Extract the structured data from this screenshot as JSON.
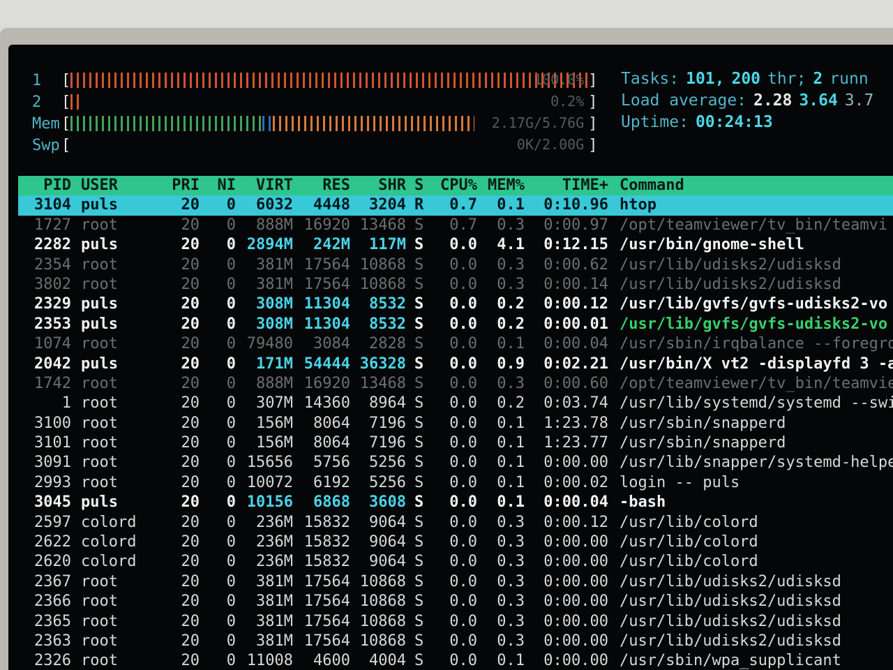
{
  "meters": [
    {
      "label": "1",
      "text": "100.0%",
      "fill": 1.0,
      "segments": [
        {
          "color": "red",
          "frac": 1.0
        }
      ]
    },
    {
      "label": "2",
      "text": "0.2%",
      "fill": 0.02,
      "segments": [
        {
          "color": "red",
          "frac": 0.02
        }
      ]
    },
    {
      "label": "Mem",
      "text": "2.17G/5.76G",
      "fill": 0.78,
      "segments": [
        {
          "color": "green",
          "frac": 0.37
        },
        {
          "color": "blue",
          "frac": 0.02
        },
        {
          "color": "orange",
          "frac": 0.39
        }
      ]
    },
    {
      "label": "Swp",
      "text": "0K/2.00G",
      "fill": 0.0,
      "segments": []
    }
  ],
  "stats": {
    "tasks_label": "Tasks:",
    "tasks_value": "101,",
    "threads_value": "200",
    "threads_label": "thr;",
    "running_value": "2",
    "running_label": "runn",
    "load_label": "Load average:",
    "load_1": "2.28",
    "load_5": "3.64",
    "load_15": "3.7",
    "uptime_label": "Uptime:",
    "uptime_value": "00:24:13"
  },
  "columns": [
    "PID",
    "USER",
    "PRI",
    "NI",
    "VIRT",
    "RES",
    "SHR",
    "S",
    "CPU%",
    "MEM%",
    "TIME+",
    "Command"
  ],
  "processes": [
    {
      "pid": "3104",
      "user": "puls",
      "pri": "20",
      "ni": "0",
      "virt": "6032",
      "res": "4448",
      "shr": "3204",
      "s": "R",
      "cpu": "0.7",
      "mem": "0.1",
      "time": "0:10.96",
      "cmd": "htop",
      "style": "sel"
    },
    {
      "pid": "1727",
      "user": "root",
      "pri": "20",
      "ni": "0",
      "virt": "888M",
      "res": "16920",
      "shr": "13468",
      "s": "S",
      "cpu": "0.7",
      "mem": "0.3",
      "time": "0:00.97",
      "cmd": "/opt/teamviewer/tv_bin/teamvi",
      "style": "dim"
    },
    {
      "pid": "2282",
      "user": "puls",
      "pri": "20",
      "ni": "0",
      "virt": "2894M",
      "res": "242M",
      "shr": "117M",
      "s": "S",
      "cpu": "0.0",
      "mem": "4.1",
      "time": "0:12.15",
      "cmd": "/usr/bin/gnome-shell",
      "style": "bright"
    },
    {
      "pid": "2354",
      "user": "root",
      "pri": "20",
      "ni": "0",
      "virt": "381M",
      "res": "17564",
      "shr": "10868",
      "s": "S",
      "cpu": "0.0",
      "mem": "0.3",
      "time": "0:00.62",
      "cmd": "/usr/lib/udisks2/udisksd",
      "style": "dim"
    },
    {
      "pid": "3802",
      "user": "root",
      "pri": "20",
      "ni": "0",
      "virt": "381M",
      "res": "17564",
      "shr": "10868",
      "s": "S",
      "cpu": "0.0",
      "mem": "0.3",
      "time": "0:00.14",
      "cmd": "/usr/lib/udisks2/udisksd",
      "style": "dim"
    },
    {
      "pid": "2329",
      "user": "puls",
      "pri": "20",
      "ni": "0",
      "virt": "308M",
      "res": "11304",
      "shr": "8532",
      "s": "S",
      "cpu": "0.0",
      "mem": "0.2",
      "time": "0:00.12",
      "cmd": "/usr/lib/gvfs/gvfs-udisks2-vo",
      "style": "bright"
    },
    {
      "pid": "2353",
      "user": "puls",
      "pri": "20",
      "ni": "0",
      "virt": "308M",
      "res": "11304",
      "shr": "8532",
      "s": "S",
      "cpu": "0.0",
      "mem": "0.2",
      "time": "0:00.01",
      "cmd": "/usr/lib/gvfs/gvfs-udisks2-vo",
      "style": "bright",
      "cmdcolor": "green"
    },
    {
      "pid": "1074",
      "user": "root",
      "pri": "20",
      "ni": "0",
      "virt": "79480",
      "res": "3084",
      "shr": "2828",
      "s": "S",
      "cpu": "0.0",
      "mem": "0.1",
      "time": "0:00.04",
      "cmd": "/usr/sbin/irqbalance --foregro",
      "style": "dim"
    },
    {
      "pid": "2042",
      "user": "puls",
      "pri": "20",
      "ni": "0",
      "virt": "171M",
      "res": "54444",
      "shr": "36328",
      "s": "S",
      "cpu": "0.0",
      "mem": "0.9",
      "time": "0:02.21",
      "cmd": "/usr/bin/X vt2 -displayfd 3 -a",
      "style": "bright"
    },
    {
      "pid": "1742",
      "user": "root",
      "pri": "20",
      "ni": "0",
      "virt": "888M",
      "res": "16920",
      "shr": "13468",
      "s": "S",
      "cpu": "0.0",
      "mem": "0.3",
      "time": "0:00.60",
      "cmd": "/opt/teamviewer/tv_bin/teamvie",
      "style": "dim"
    },
    {
      "pid": "1",
      "user": "root",
      "pri": "20",
      "ni": "0",
      "virt": "307M",
      "res": "14360",
      "shr": "8964",
      "s": "S",
      "cpu": "0.0",
      "mem": "0.2",
      "time": "0:03.74",
      "cmd": "/usr/lib/systemd/systemd --swi",
      "style": "normal"
    },
    {
      "pid": "3100",
      "user": "root",
      "pri": "20",
      "ni": "0",
      "virt": "156M",
      "res": "8064",
      "shr": "7196",
      "s": "S",
      "cpu": "0.0",
      "mem": "0.1",
      "time": "1:23.78",
      "cmd": "/usr/sbin/snapperd",
      "style": "normal"
    },
    {
      "pid": "3101",
      "user": "root",
      "pri": "20",
      "ni": "0",
      "virt": "156M",
      "res": "8064",
      "shr": "7196",
      "s": "S",
      "cpu": "0.0",
      "mem": "0.1",
      "time": "1:23.77",
      "cmd": "/usr/sbin/snapperd",
      "style": "normal"
    },
    {
      "pid": "3091",
      "user": "root",
      "pri": "20",
      "ni": "0",
      "virt": "15656",
      "res": "5756",
      "shr": "5256",
      "s": "S",
      "cpu": "0.0",
      "mem": "0.1",
      "time": "0:00.00",
      "cmd": "/usr/lib/snapper/systemd-helpe",
      "style": "normal"
    },
    {
      "pid": "2993",
      "user": "root",
      "pri": "20",
      "ni": "0",
      "virt": "10072",
      "res": "6192",
      "shr": "5256",
      "s": "S",
      "cpu": "0.0",
      "mem": "0.1",
      "time": "0:00.02",
      "cmd": "login -- puls",
      "style": "normal"
    },
    {
      "pid": "3045",
      "user": "puls",
      "pri": "20",
      "ni": "0",
      "virt": "10156",
      "res": "6868",
      "shr": "3608",
      "s": "S",
      "cpu": "0.0",
      "mem": "0.1",
      "time": "0:00.04",
      "cmd": "-bash",
      "style": "bright"
    },
    {
      "pid": "2597",
      "user": "colord",
      "pri": "20",
      "ni": "0",
      "virt": "236M",
      "res": "15832",
      "shr": "9064",
      "s": "S",
      "cpu": "0.0",
      "mem": "0.3",
      "time": "0:00.12",
      "cmd": "/usr/lib/colord",
      "style": "normal"
    },
    {
      "pid": "2622",
      "user": "colord",
      "pri": "20",
      "ni": "0",
      "virt": "236M",
      "res": "15832",
      "shr": "9064",
      "s": "S",
      "cpu": "0.0",
      "mem": "0.3",
      "time": "0:00.00",
      "cmd": "/usr/lib/colord",
      "style": "normal"
    },
    {
      "pid": "2620",
      "user": "colord",
      "pri": "20",
      "ni": "0",
      "virt": "236M",
      "res": "15832",
      "shr": "9064",
      "s": "S",
      "cpu": "0.0",
      "mem": "0.3",
      "time": "0:00.00",
      "cmd": "/usr/lib/colord",
      "style": "normal"
    },
    {
      "pid": "2367",
      "user": "root",
      "pri": "20",
      "ni": "0",
      "virt": "381M",
      "res": "17564",
      "shr": "10868",
      "s": "S",
      "cpu": "0.0",
      "mem": "0.3",
      "time": "0:00.00",
      "cmd": "/usr/lib/udisks2/udisksd",
      "style": "normal"
    },
    {
      "pid": "2366",
      "user": "root",
      "pri": "20",
      "ni": "0",
      "virt": "381M",
      "res": "17564",
      "shr": "10868",
      "s": "S",
      "cpu": "0.0",
      "mem": "0.3",
      "time": "0:00.00",
      "cmd": "/usr/lib/udisks2/udisksd",
      "style": "normal"
    },
    {
      "pid": "2365",
      "user": "root",
      "pri": "20",
      "ni": "0",
      "virt": "381M",
      "res": "17564",
      "shr": "10868",
      "s": "S",
      "cpu": "0.0",
      "mem": "0.3",
      "time": "0:00.00",
      "cmd": "/usr/lib/udisks2/udisksd",
      "style": "normal"
    },
    {
      "pid": "2363",
      "user": "root",
      "pri": "20",
      "ni": "0",
      "virt": "381M",
      "res": "17564",
      "shr": "10868",
      "s": "S",
      "cpu": "0.0",
      "mem": "0.3",
      "time": "0:00.00",
      "cmd": "/usr/lib/udisks2/udisksd",
      "style": "normal"
    },
    {
      "pid": "2326",
      "user": "root",
      "pri": "20",
      "ni": "0",
      "virt": "11008",
      "res": "4600",
      "shr": "4004",
      "s": "S",
      "cpu": "0.0",
      "mem": "0.1",
      "time": "0:00.00",
      "cmd": "/usr/sbin/wpa_supplicant",
      "style": "normal"
    }
  ]
}
